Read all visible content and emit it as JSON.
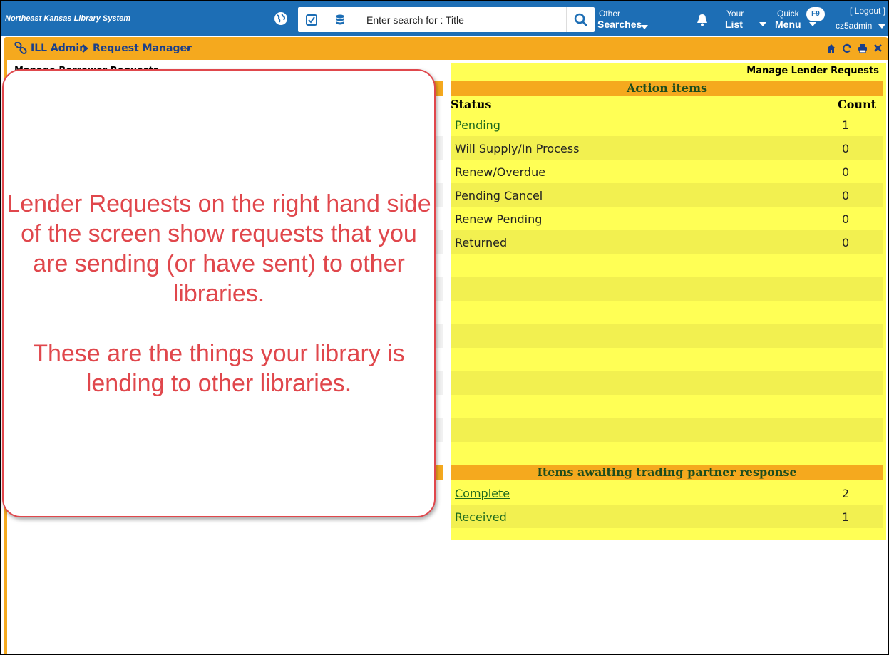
{
  "topbar": {
    "org_name": "Northeast Kansas Library System",
    "search_placeholder": "Enter search for : Title",
    "other_label": "Other",
    "searches_label": "Searches",
    "your_label": "Your",
    "list_label": "List",
    "quick_label": "Quick",
    "menu_label": "Menu",
    "f9_badge": "F9",
    "logout_label": "[ Logout ]",
    "username": "cz5admin"
  },
  "breadcrumb": {
    "section": "ILL Admin",
    "page": "Request Manager"
  },
  "left_panel": {
    "title": "Manage Borrower Requests"
  },
  "right_panel": {
    "title": "Manage Lender Requests",
    "action_items_header": "Action items",
    "status_col": "Status",
    "count_col": "Count",
    "action_rows": [
      {
        "status": "Pending",
        "count": "1"
      },
      {
        "status": "Will Supply/In Process",
        "count": "0"
      },
      {
        "status": "Renew/Overdue",
        "count": "0"
      },
      {
        "status": "Pending Cancel",
        "count": "0"
      },
      {
        "status": "Renew Pending",
        "count": "0"
      },
      {
        "status": "Returned",
        "count": "0"
      }
    ],
    "awaiting_header": "Items awaiting trading partner response",
    "awaiting_rows": [
      {
        "status": "Complete",
        "count": "2"
      },
      {
        "status": "Received",
        "count": "1"
      }
    ]
  },
  "callout": {
    "paragraph1": "Lender Requests on the right hand side of the screen show requests that you are sending (or have sent) to other libraries.",
    "paragraph2": "These are the things your library is lending to other libraries."
  },
  "colors": {
    "nav_blue": "#1d6eb5",
    "orange": "#f5a91e",
    "yellow": "#ffff55",
    "callout_red": "#e0474c",
    "link_green": "#1e6a1e"
  }
}
